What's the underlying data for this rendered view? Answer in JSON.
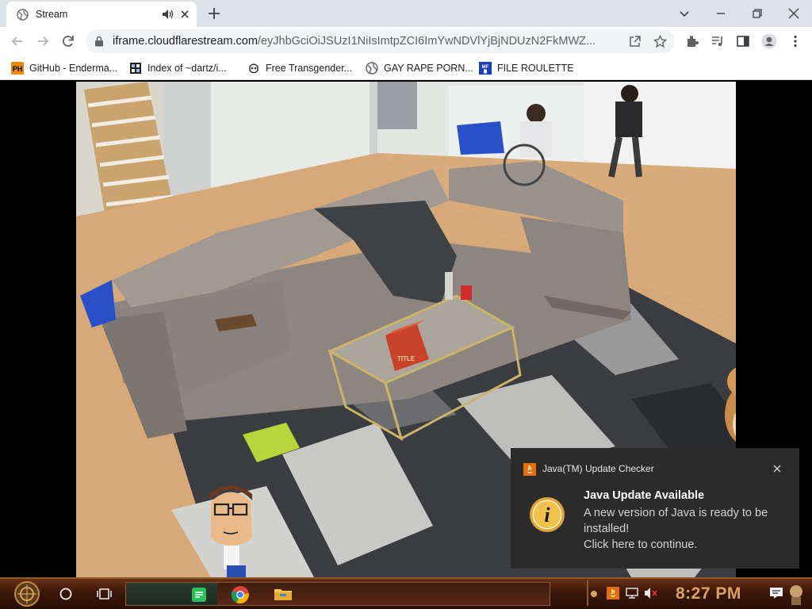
{
  "tab": {
    "title": "Stream"
  },
  "toolbar": {
    "url_host": "iframe.cloudflarestream.com",
    "url_path": "/eyJhbGciOiJSUzI1NiIsImtpZCI6ImYwNDVlYjBjNDUzN2FkMWZ..."
  },
  "bookmarks": [
    {
      "label": "GitHub - Enderma...",
      "icon": "github-ph-icon"
    },
    {
      "label": "Index of ~dartz/i...",
      "icon": "folder-index-icon"
    },
    {
      "label": "Free Transgender...",
      "icon": "bookmark-site-icon"
    },
    {
      "label": "GAY RAPE PORN...",
      "icon": "globe-icon"
    },
    {
      "label": "FILE ROULETTE",
      "icon": "file-roulette-icon"
    }
  ],
  "video": {
    "overlay_box_text": "TITLE"
  },
  "toast": {
    "app_name": "Java(TM) Update Checker",
    "heading": "Java Update Available",
    "line1": "A new version of Java is ready to be",
    "line2": "installed!",
    "line3": "Click here to continue."
  },
  "taskbar": {
    "time": "8:27 PM"
  },
  "colors": {
    "chrome_tabstrip": "#dee1e6",
    "toast_bg": "#2b2b2b",
    "clock": "#d6a45a",
    "taskbar": "#3a1608"
  }
}
